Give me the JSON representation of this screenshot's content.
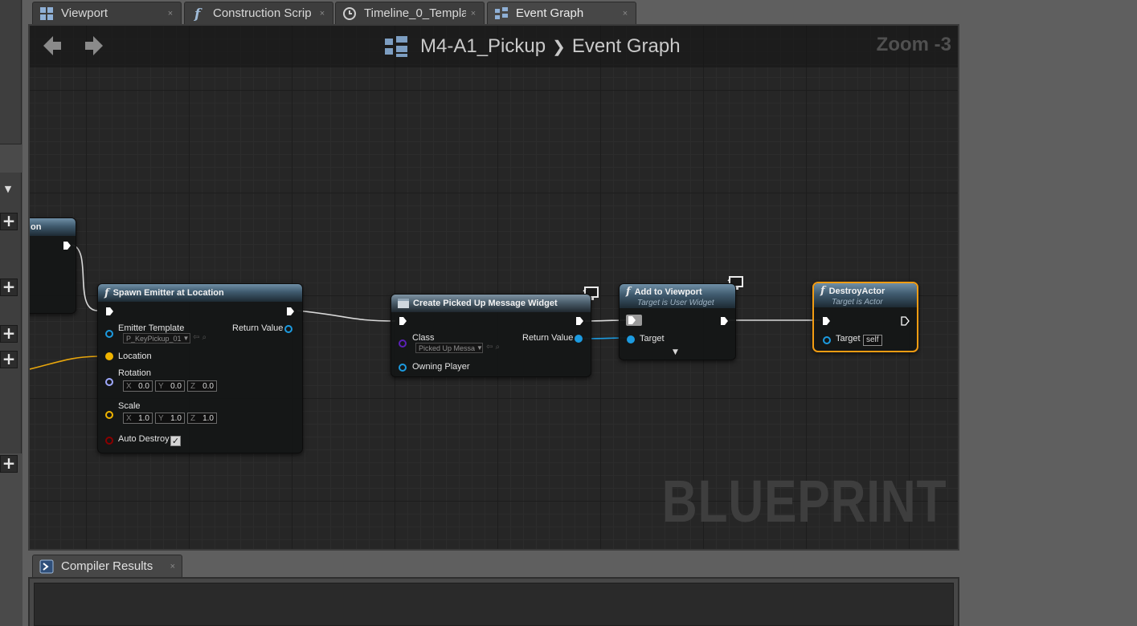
{
  "tabs": [
    {
      "label": "Viewport",
      "icon": "viewport-icon",
      "active": false
    },
    {
      "label": "Construction Scrip",
      "icon": "function-icon",
      "active": false
    },
    {
      "label": "Timeline_0_Templa",
      "icon": "clock-icon",
      "active": false
    },
    {
      "label": "Event Graph",
      "icon": "event-graph-icon",
      "active": true
    }
  ],
  "graph": {
    "breadcrumb_blueprint": "M4-A1_Pickup",
    "breadcrumb_graph": "Event Graph",
    "zoom": "Zoom -3",
    "watermark": "BLUEPRINT"
  },
  "nodes": {
    "partial": {
      "title": "on"
    },
    "spawn": {
      "title": "Spawn Emitter at Location",
      "emitter_template": "Emitter Template",
      "emitter_value": "P_KeyPickup_01",
      "return_value": "Return Value",
      "location": "Location",
      "rotation": "Rotation",
      "rotation_x": "0.0",
      "rotation_y": "0.0",
      "rotation_z": "0.0",
      "scale": "Scale",
      "scale_x": "1.0",
      "scale_y": "1.0",
      "scale_z": "1.0",
      "auto_destroy": "Auto Destroy",
      "axis_x": "X",
      "axis_y": "Y",
      "axis_z": "Z"
    },
    "create_widget": {
      "title": "Create Picked Up Message Widget",
      "class": "Class",
      "class_value": "Picked Up Messa",
      "return_value": "Return Value",
      "owning_player": "Owning Player"
    },
    "add_viewport": {
      "title": "Add to Viewport",
      "subtitle": "Target is User Widget",
      "target": "Target"
    },
    "destroy_actor": {
      "title": "DestroyActor",
      "subtitle": "Target is Actor",
      "target": "Target",
      "self": "self"
    }
  },
  "results": {
    "tab_label": "Compiler Results"
  },
  "colors": {
    "exec": "#ffffff",
    "object_pin": "#0ea5e9",
    "vector_pin": "#f0b400",
    "rotator_pin": "#9fa9ff",
    "bool_pin": "#8b0000",
    "class_pin": "#5b21b6",
    "selection": "#f39c12"
  }
}
